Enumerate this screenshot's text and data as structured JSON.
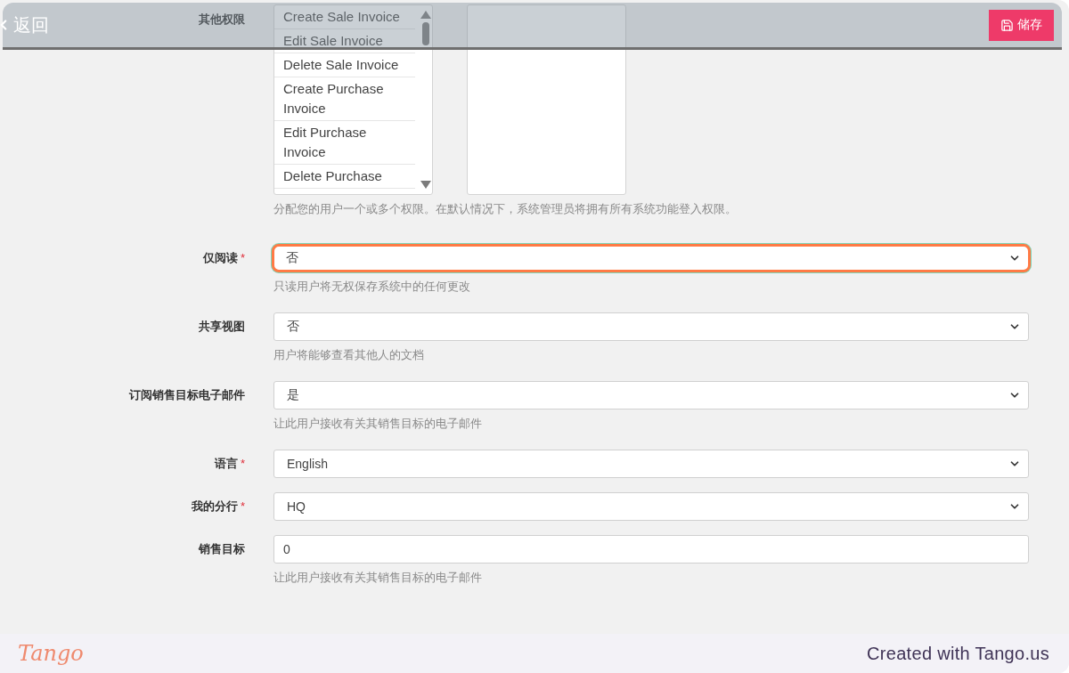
{
  "header": {
    "back_label": "返回",
    "save_label": "储存"
  },
  "permissions": {
    "label": "其他权限",
    "items": [
      "Create Sale Invoice",
      "Edit Sale Invoice",
      "Delete Sale Invoice",
      "Create Purchase Invoice",
      "Edit Purchase Invoice",
      "Delete Purchase"
    ],
    "help": "分配您的用户一个或多个权限。在默认情况下，系统管理员将拥有所有系统功能登入权限。"
  },
  "fields": [
    {
      "label": "仅阅读",
      "required_mark": "*",
      "kind": "select",
      "value": "否",
      "focused": true,
      "help": "只读用户将无权保存系统中的任何更改"
    },
    {
      "label": "共享视图",
      "kind": "select",
      "value": "否",
      "help": "用户将能够查看其他人的文档"
    },
    {
      "label": "订阅销售目标电子邮件",
      "kind": "select",
      "value": "是",
      "help": "让此用户接收有关其销售目标的电子邮件"
    },
    {
      "label": "语言",
      "required_mark": "*",
      "kind": "select",
      "value": "English"
    },
    {
      "label": "我的分行",
      "required_mark": "*",
      "kind": "select",
      "value": "HQ"
    },
    {
      "label": "销售目标",
      "kind": "input",
      "value": "0",
      "help": "让此用户接收有关其销售目标的电子邮件"
    }
  ],
  "footer": {
    "logo": "Tango",
    "credit": "Created with Tango.us"
  }
}
